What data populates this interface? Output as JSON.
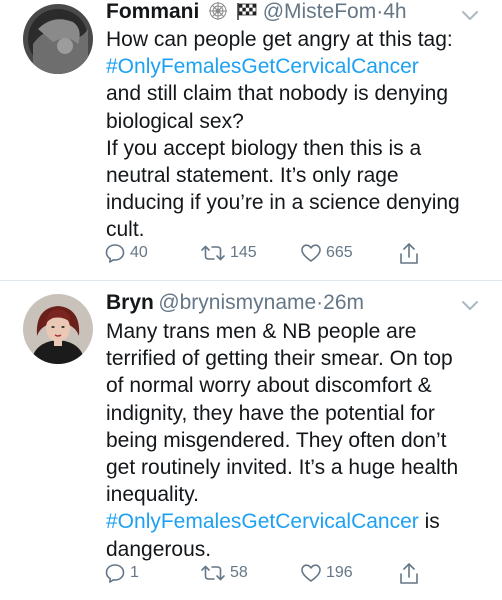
{
  "tweets": [
    {
      "display_name": "Fommani",
      "handle": "@MisteFom",
      "separator": "·",
      "time": "4h",
      "badges": [
        "spiderweb-icon",
        "checkered-flag-icon"
      ],
      "lines": [
        {
          "text": "How can people get angry at this tag:"
        },
        {
          "text": "#OnlyFemalesGetCervicalCancer",
          "hashtag": true
        },
        {
          "text": "and still claim that nobody is denying"
        },
        {
          "text": "biological sex?"
        },
        {
          "text": "If you accept biology then this is a"
        },
        {
          "text": "neutral statement. It’s only rage"
        },
        {
          "text": "inducing if you’re in a science denying"
        },
        {
          "text": "cult."
        }
      ],
      "replies": "40",
      "retweets": "145",
      "likes": "665"
    },
    {
      "display_name": "Bryn",
      "handle": "@brynismyname",
      "separator": "·",
      "time": "26m",
      "lines": [
        {
          "text": "Many trans men & NB people are"
        },
        {
          "text": "terrified of getting their smear. On top"
        },
        {
          "text": "of normal worry about discomfort &"
        },
        {
          "text": "indignity, they have the potential for"
        },
        {
          "text": "being misgendered. They often don’t"
        },
        {
          "text": "get routinely invited. It’s a huge health"
        },
        {
          "text": "inequality."
        },
        {
          "text": "#OnlyFemalesGetCervicalCancer",
          "hashtag": true,
          "suffix": " is"
        },
        {
          "text": "dangerous."
        }
      ],
      "replies": "1",
      "retweets": "58",
      "likes": "196"
    }
  ],
  "colors": {
    "hashtag": "#1da1f2",
    "secondary_text": "#657786",
    "primary_text": "#14171a",
    "divider": "#e1e8ed"
  }
}
